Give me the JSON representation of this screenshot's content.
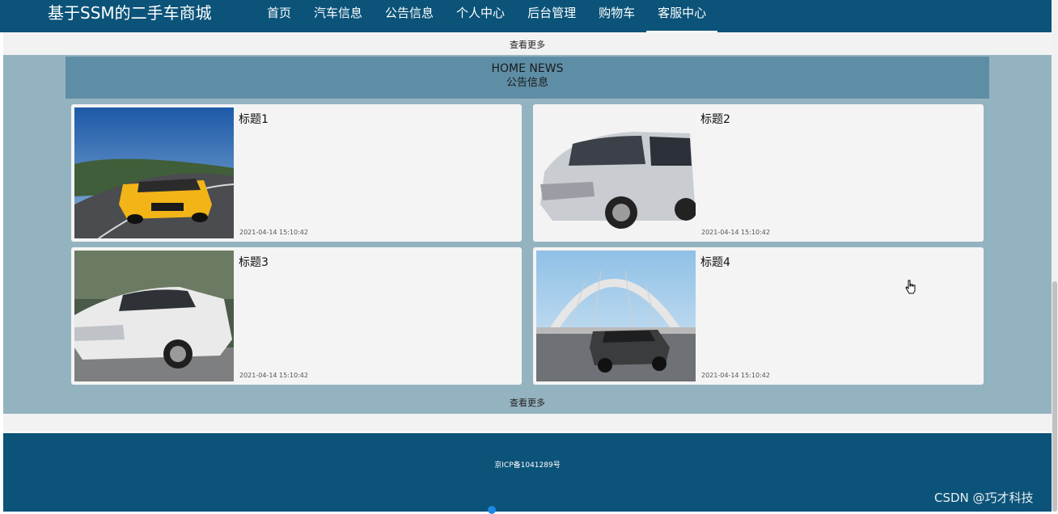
{
  "header": {
    "brand": "基于SSM的二手车商城",
    "nav": [
      {
        "label": "首页"
      },
      {
        "label": "汽车信息"
      },
      {
        "label": "公告信息"
      },
      {
        "label": "个人中心"
      },
      {
        "label": "后台管理"
      },
      {
        "label": "购物车"
      },
      {
        "label": "客服中心",
        "active": true
      }
    ]
  },
  "top_strip": {
    "more_label": "查看更多"
  },
  "news": {
    "heading_en": "HOME NEWS",
    "heading_cn": "公告信息",
    "items": [
      {
        "title": "标题1",
        "date": "2021-04-14 15:10:42",
        "image": "yellow-sports-car"
      },
      {
        "title": "标题2",
        "date": "2021-04-14 15:10:42",
        "image": "white-minivan"
      },
      {
        "title": "标题3",
        "date": "2021-04-14 15:10:42",
        "image": "white-sedan"
      },
      {
        "title": "标题4",
        "date": "2021-04-14 15:10:42",
        "image": "dark-sedan-on-bridge"
      }
    ],
    "more_label": "查看更多"
  },
  "footer": {
    "icp": "京ICP备1041289号"
  },
  "watermark": "CSDN @巧才科技",
  "colors": {
    "header_bg": "#0b5379",
    "section_bg": "#94b3c0",
    "section_head_bg": "#5e8ea5"
  }
}
